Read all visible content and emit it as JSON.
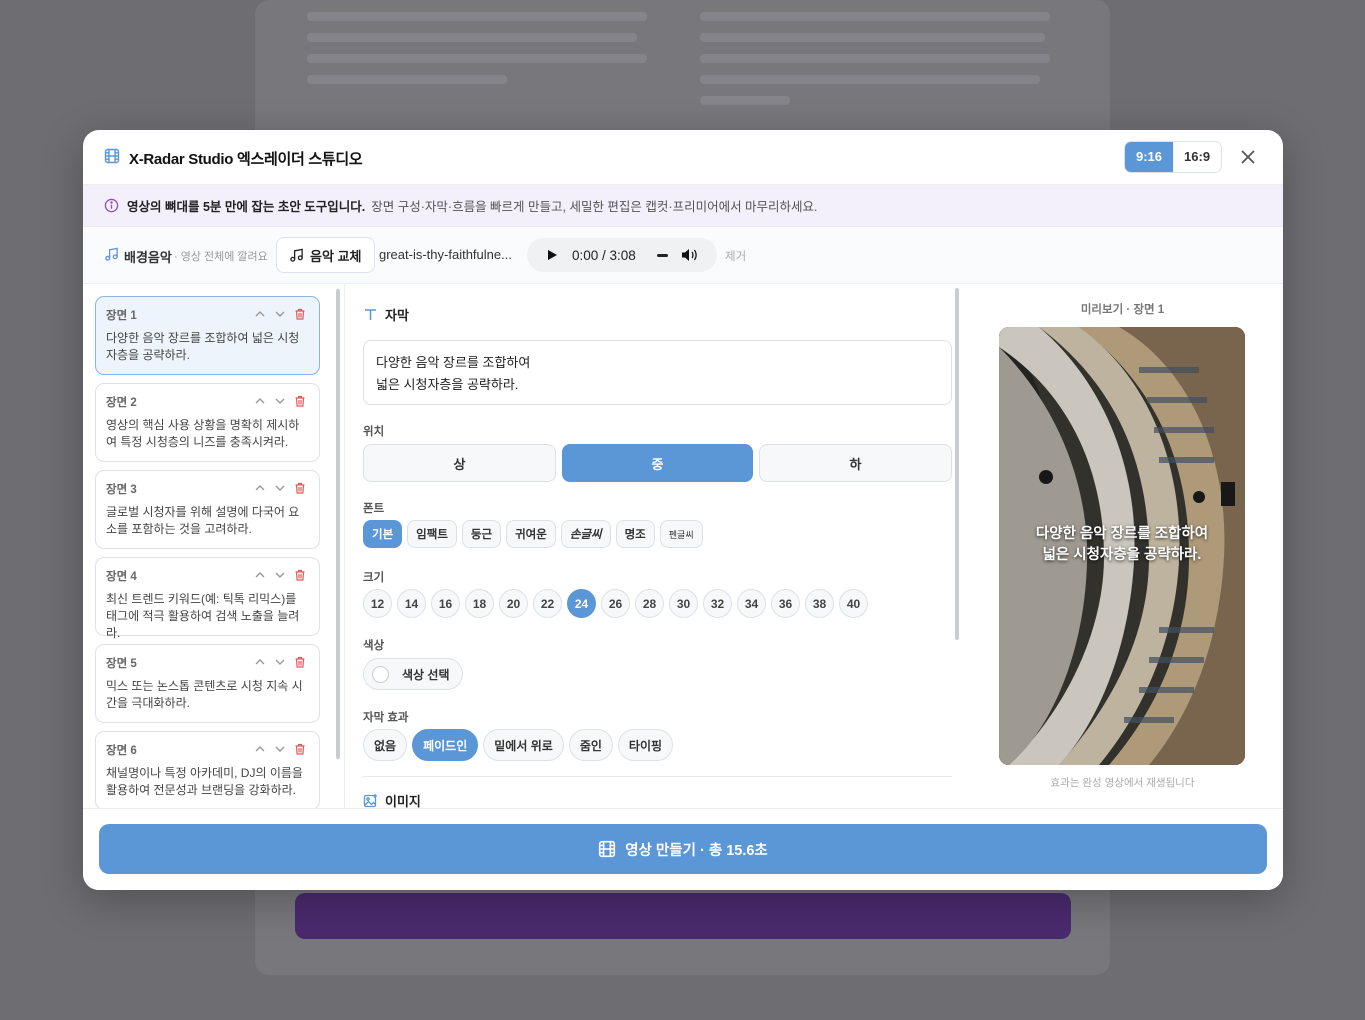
{
  "header": {
    "title": "X-Radar Studio 엑스레이더 스튜디오",
    "ratio_options": [
      "9:16",
      "16:9"
    ],
    "ratio_selected": "9:16"
  },
  "notice": {
    "bold": "영상의 뼈대를 5분 만에 잡는 초안 도구입니다.",
    "text": "장면 구성·자막·흐름을 빠르게 만들고, 세밀한 편집은 캡컷·프리미어에서 마무리하세요."
  },
  "music": {
    "label": "배경음악",
    "sub": "· 영상 전체에 깔려요",
    "swap_label": "음악 교체",
    "file_name": "great-is-thy-faithfulne...",
    "time": "0:00 / 3:08",
    "remove_label": "제거"
  },
  "scenes": [
    {
      "name": "장면 1",
      "desc": "다양한 음악 장르를 조합하여 넓은 시청자층을 공략하라."
    },
    {
      "name": "장면 2",
      "desc": "영상의 핵심 사용 상황을 명확히 제시하여 특정 시청층의 니즈를 충족시켜라."
    },
    {
      "name": "장면 3",
      "desc": "글로벌 시청자를 위해 설명에 다국어 요소를 포함하는 것을 고려하라."
    },
    {
      "name": "장면 4",
      "desc": "최신 트렌드 키워드(예: 틱톡 리믹스)를 태그에 적극 활용하여 검색 노출을 늘려라."
    },
    {
      "name": "장면 5",
      "desc": "믹스 또는 논스톱 콘텐츠로 시청 지속 시간을 극대화하라."
    },
    {
      "name": "장면 6",
      "desc": "채널명이나 특정 아카데미, DJ의 이름을 활용하여 전문성과 브랜딩을 강화하라."
    }
  ],
  "editor": {
    "subtitle_title": "자막",
    "subtitle_text": "다양한 음악 장르를 조합하여\n넓은 시청자층을 공략하라.",
    "position_label": "위치",
    "positions": [
      "상",
      "중",
      "하"
    ],
    "position_selected": "중",
    "font_label": "폰트",
    "fonts": [
      "기본",
      "임팩트",
      "둥근",
      "귀여운",
      "손글씨",
      "명조",
      "펜글씨"
    ],
    "font_selected": "기본",
    "size_label": "크기",
    "sizes": [
      "12",
      "14",
      "16",
      "18",
      "20",
      "22",
      "24",
      "26",
      "28",
      "30",
      "32",
      "34",
      "36",
      "38",
      "40"
    ],
    "size_selected": "24",
    "color_label": "색상",
    "color_button": "색상 선택",
    "effect_label": "자막 효과",
    "effects": [
      "없음",
      "페이드인",
      "밑에서 위로",
      "줌인",
      "타이핑"
    ],
    "effect_selected": "페이드인",
    "image_title": "이미지"
  },
  "preview": {
    "title": "미리보기 · 장면 1",
    "caption": "다양한 음악 장르를 조합하여\n넓은 시청자층을 공략하라.",
    "note": "효과는 완성 영상에서 재생됩니다"
  },
  "footer": {
    "make_label": "영상 만들기 · 총 15.6초"
  },
  "colors": {
    "accent": "#5b96d6",
    "delete": "#e05a5a",
    "notice_bg": "#f3effb"
  }
}
